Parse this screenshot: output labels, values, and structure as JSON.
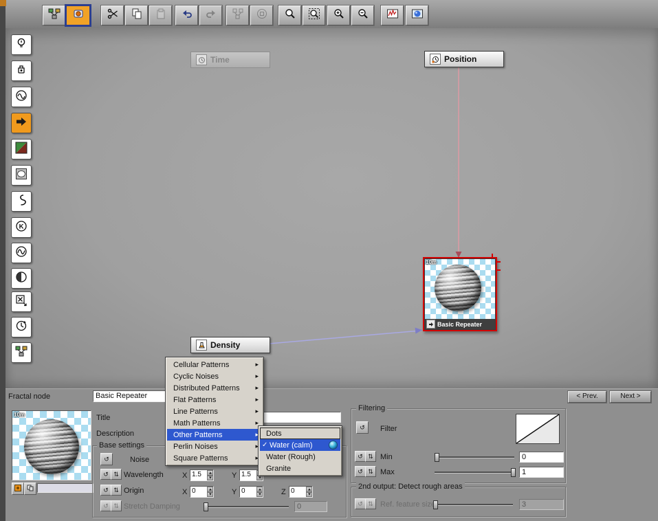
{
  "colors": {
    "selection_red": "#d40000",
    "menu_highlight_blue": "#2e58cf",
    "active_orange": "#f09a1d"
  },
  "toolbar": {
    "buttons": [
      {
        "name": "node-overview-button"
      },
      {
        "name": "new-function-button",
        "active": true
      },
      {
        "name": "cut-button"
      },
      {
        "name": "copy-button"
      },
      {
        "name": "paste-button",
        "disabled": true
      },
      {
        "name": "undo-button"
      },
      {
        "name": "redo-button",
        "disabled": true
      },
      {
        "name": "group-nodes-button",
        "disabled": true
      },
      {
        "name": "expand-nodes-button",
        "disabled": true
      },
      {
        "name": "zoom-tool-button"
      },
      {
        "name": "zoom-region-button"
      },
      {
        "name": "zoom-in-button"
      },
      {
        "name": "zoom-out-button"
      },
      {
        "name": "curve-preview-button"
      },
      {
        "name": "sphere-preview-button"
      }
    ]
  },
  "sidebar": {
    "items": [
      {
        "name": "light-node-button"
      },
      {
        "name": "material-node-button"
      },
      {
        "name": "wave-node-button"
      },
      {
        "name": "input-node-button",
        "active": true
      },
      {
        "name": "gradient-node-button"
      },
      {
        "name": "blob-node-button"
      },
      {
        "name": "curve-node-button"
      },
      {
        "name": "constant-node-button"
      },
      {
        "name": "sine-node-button"
      },
      {
        "name": "mask-node-button"
      },
      {
        "name": "variable-node-button"
      },
      {
        "name": "rotation-node-button"
      },
      {
        "name": "network-node-button"
      }
    ]
  },
  "canvas": {
    "nodes": {
      "time": {
        "label": "Time",
        "enabled": false
      },
      "position": {
        "label": "Position",
        "enabled": true
      },
      "density": {
        "label": "Density",
        "enabled": true
      },
      "repeater": {
        "label": "Basic Repeater",
        "scale_label": "10m",
        "selected": true
      }
    }
  },
  "context_menu": {
    "items": [
      {
        "label": "Cellular Patterns"
      },
      {
        "label": "Cyclic Noises"
      },
      {
        "label": "Distributed Patterns"
      },
      {
        "label": "Flat Patterns"
      },
      {
        "label": "Line Patterns"
      },
      {
        "label": "Math Patterns"
      },
      {
        "label": "Other Patterns",
        "highlighted": true
      },
      {
        "label": "Perlin Noises"
      },
      {
        "label": "Square Patterns"
      }
    ]
  },
  "pattern_submenu": {
    "items": [
      {
        "label": "Dots",
        "focused": true
      },
      {
        "label": "Water (calm)",
        "checked": true,
        "highlighted": true
      },
      {
        "label": "Water (Rough)"
      },
      {
        "label": "Granite"
      }
    ]
  },
  "panel": {
    "node_type_label": "Fractal node",
    "node_name_value": "Basic Repeater",
    "prev_button_label": "< Prev.",
    "next_button_label": "Next >",
    "preview_scale_label": "10m",
    "title_label": "Title",
    "description_label": "Description",
    "base_settings": {
      "group_label": "Base settings",
      "noise_label": "Noise",
      "wavelength_label": "Wavelength",
      "origin_label": "Origin",
      "stretch_label": "Stretch Damping",
      "x_label": "X",
      "y_label": "Y",
      "z_label": "Z",
      "wavelength_x": "1.5",
      "wavelength_y": "1.5",
      "origin_x": "0",
      "origin_y": "0",
      "origin_z": "0",
      "stretch_value": "0"
    },
    "filtering": {
      "group_label": "Filtering",
      "filter_label": "Filter",
      "min_label": "Min",
      "max_label": "Max",
      "min_value": "0",
      "max_value": "1"
    },
    "second_output": {
      "group_label": "2nd output: Detect rough areas",
      "ref_label": "Ref. feature size",
      "ref_value": "3"
    }
  }
}
